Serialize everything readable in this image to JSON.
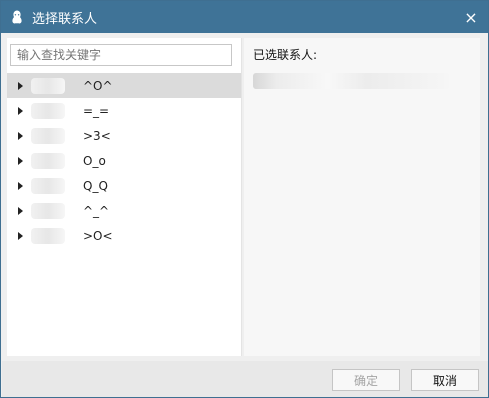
{
  "window": {
    "title": "选择联系人",
    "close_icon": "×"
  },
  "search": {
    "placeholder": "输入查找关键字"
  },
  "tree_items": [
    {
      "label": "^O^"
    },
    {
      "label": "=_="
    },
    {
      "label": ">3<"
    },
    {
      "label": "O_o"
    },
    {
      "label": "Q_Q"
    },
    {
      "label": "^_^"
    },
    {
      "label": ">O<"
    }
  ],
  "right_panel": {
    "title": "已选联系人:"
  },
  "buttons": {
    "ok": "确定",
    "cancel": "取消"
  },
  "colors": {
    "title_bar": "#3f7397",
    "selected_row": "#dbdbdb",
    "disabled_text": "#a4a4a4"
  }
}
